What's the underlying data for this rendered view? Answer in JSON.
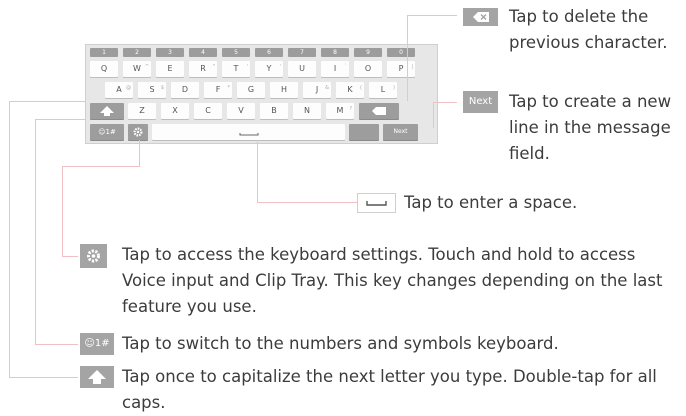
{
  "keyboard": {
    "number_keys": [
      "1",
      "2",
      "3",
      "4",
      "5",
      "6",
      "7",
      "8",
      "9",
      "0"
    ],
    "row1": [
      {
        "label": "Q",
        "sup": ""
      },
      {
        "label": "W",
        "sup": "^"
      },
      {
        "label": "E",
        "sup": ""
      },
      {
        "label": "R",
        "sup": "\""
      },
      {
        "label": "T",
        "sup": "'"
      },
      {
        "label": "Y",
        "sup": "'"
      },
      {
        "label": "U",
        "sup": ""
      },
      {
        "label": "I",
        "sup": "`"
      },
      {
        "label": "O",
        "sup": ""
      },
      {
        "label": "P",
        "sup": "|"
      }
    ],
    "row2": [
      {
        "label": "A",
        "sup": "@"
      },
      {
        "label": "S",
        "sup": "$"
      },
      {
        "label": "D",
        "sup": ""
      },
      {
        "label": "F",
        "sup": "*"
      },
      {
        "label": "G",
        "sup": ""
      },
      {
        "label": "H",
        "sup": ""
      },
      {
        "label": "J",
        "sup": "&"
      },
      {
        "label": "K",
        "sup": "("
      },
      {
        "label": "L",
        "sup": ")"
      }
    ],
    "row3": [
      {
        "label": "Z",
        "sup": ""
      },
      {
        "label": "X",
        "sup": ""
      },
      {
        "label": "C",
        "sup": ""
      },
      {
        "label": "V",
        "sup": ""
      },
      {
        "label": "B",
        "sup": ""
      },
      {
        "label": "N",
        "sup": ""
      },
      {
        "label": "M",
        "sup": "?"
      }
    ],
    "symbols_key": "☺1#",
    "next_key": "Next"
  },
  "callouts": {
    "delete": "Tap to delete the previous character.",
    "next_icon": "Next",
    "next": "Tap to create a new line in the message field.",
    "space": "Tap to enter a space.",
    "settings": "Tap to access the keyboard settings. Touch and hold to access Voice input and Clip Tray. This key changes depending on the last feature you use.",
    "symbols_icon": "☺1#",
    "symbols": "Tap to switch to the numbers and symbols keyboard.",
    "shift": "Tap once to capitalize the next letter you type. Double-tap for all caps."
  },
  "colors": {
    "leader_line": "#f0c0c2",
    "icon_gray": "#a4a4a4",
    "text": "#3c3c3c"
  }
}
